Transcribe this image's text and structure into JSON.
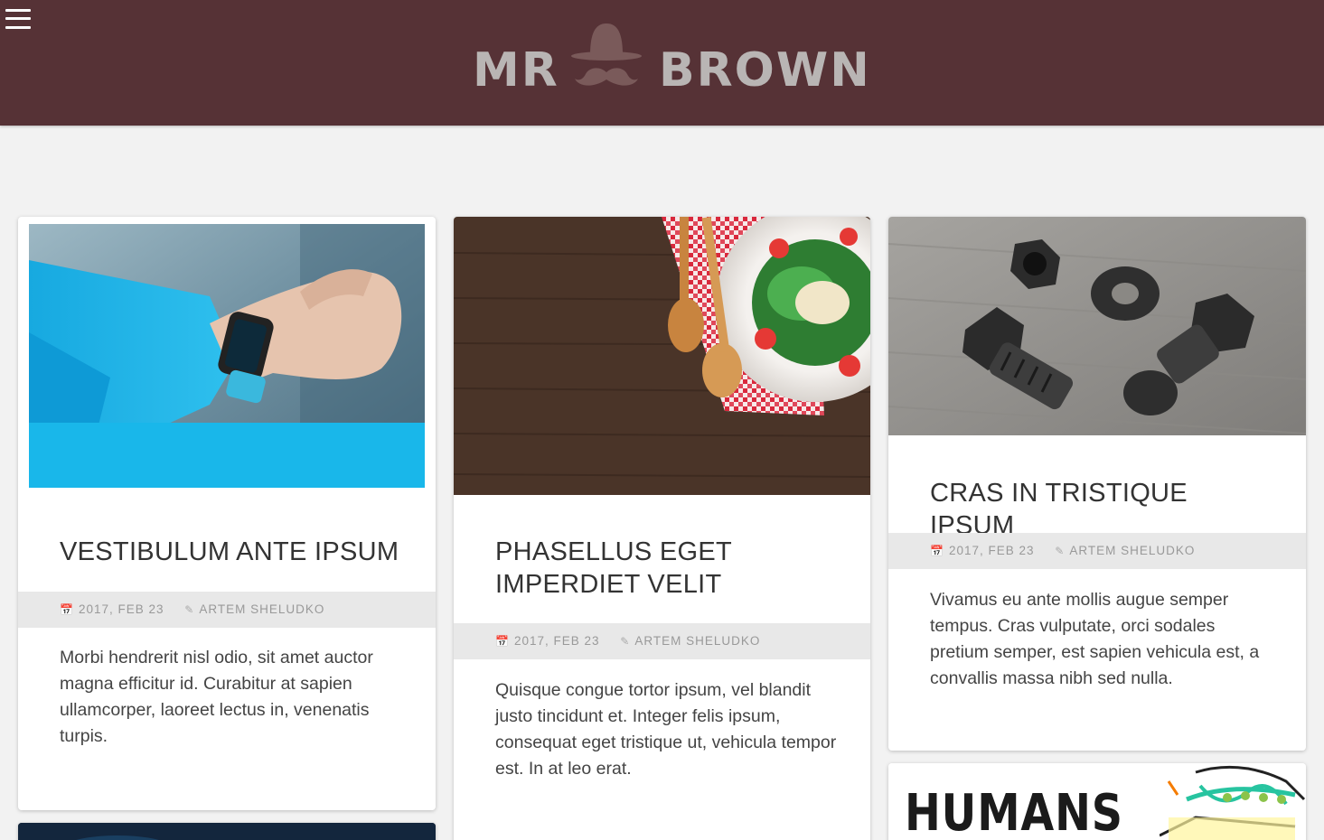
{
  "header": {
    "menu_icon": "hamburger-menu-icon",
    "logo": {
      "word_left": "MR",
      "word_right": "BROWN",
      "icon": "bowler-hat-mustache-icon"
    },
    "background_color": "#563236"
  },
  "posts": [
    {
      "title": "VESTIBULUM ANTE IPSUM",
      "date": "2017, FEB 23",
      "author": "ARTEM SHELUDKO",
      "excerpt": "Morbi hendrerit nisl odio, sit amet auctor magna efficitur id. Curabitur at sapien ullamcorper, laoreet lectus in, venenatis turpis.",
      "image": "smartwatch-photo"
    },
    {
      "title": "PHASELLUS EGET IMPERDIET VELIT",
      "date": "2017, FEB 23",
      "author": "ARTEM SHELUDKO",
      "excerpt": "Quisque congue tortor ipsum, vel blandit justo tincidunt et. Integer felis ipsum, consequat eget tristique ut, vehicula tempor est. In at leo erat.",
      "image": "salad-plate-photo"
    },
    {
      "title": "CRAS IN TRISTIQUE IPSUM",
      "date": "2017, FEB 23",
      "author": "ARTEM SHELUDKO",
      "excerpt": "Vivamus eu ante mollis augue semper tempus. Cras vulputate, orci sodales pretium semper, est sapien vehicula est, a convallis massa nibh sed nulla.",
      "image": "bolts-nuts-photo"
    },
    {
      "image_text": "HUMANS",
      "image": "humans-sketch-image"
    }
  ],
  "meta_icons": {
    "date": "calendar-icon",
    "author": "edit-icon"
  }
}
